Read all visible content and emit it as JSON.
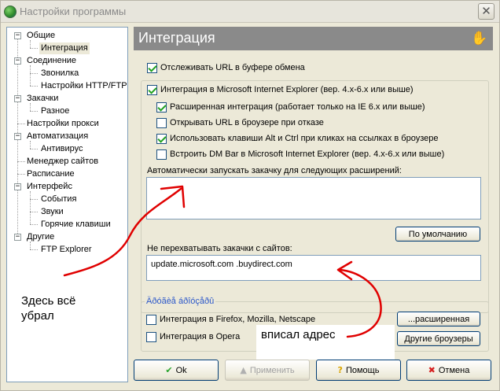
{
  "window": {
    "title": "Настройки программы",
    "close_glyph": "✕"
  },
  "tree": {
    "items": [
      {
        "label": "Общие",
        "box": "−"
      },
      {
        "label": "Интеграция"
      },
      {
        "label": "Соединение",
        "box": "−"
      },
      {
        "label": "Звонилка"
      },
      {
        "label": "Настройки HTTP/FTP"
      },
      {
        "label": "Закачки",
        "box": "−"
      },
      {
        "label": "Разное"
      },
      {
        "label": "Настройки прокси"
      },
      {
        "label": "Автоматизация",
        "box": "−"
      },
      {
        "label": "Антивирус"
      },
      {
        "label": "Менеджер сайтов"
      },
      {
        "label": "Расписание"
      },
      {
        "label": "Интерфейс",
        "box": "−"
      },
      {
        "label": "События"
      },
      {
        "label": "Звуки"
      },
      {
        "label": "Горячие клавиши"
      },
      {
        "label": "Другие",
        "box": "−"
      },
      {
        "label": "FTP Explorer"
      }
    ]
  },
  "panel": {
    "title": "Интеграция",
    "icon": "hand-icon",
    "clipboard_watch": {
      "label": "Отслеживать URL в буфере обмена",
      "checked": true
    },
    "ie_integration": {
      "label": "Интеграция в Microsoft Internet Explorer (вер. 4.x-6.x или выше)",
      "checked": true
    },
    "ie_options": [
      {
        "label": "Расширенная интеграция (работает только на IE 6.x или выше)",
        "checked": true
      },
      {
        "label": "Открывать URL в броузере при отказе",
        "checked": false
      },
      {
        "label": "Использовать клавиши Alt и Ctrl при кликах на ссылках в броузере",
        "checked": true
      },
      {
        "label": "Встроить DM Bar в Microsoft Internet Explorer (вер. 4.x-6.x или выше)",
        "checked": false
      }
    ],
    "auto_ext_label": "Автоматически запускать закачку для следующих расширений:",
    "auto_ext_value": "",
    "default_button": "По умолчанию",
    "skip_sites_label": "Не перехватывать закачки с сайтов:",
    "skip_sites_value": "update.microsoft.com .buydirect.com",
    "other_group_title": "Äðóãèå áðîóçåðû",
    "firefox": {
      "label": "Интеграция в Firefox, Mozilla, Netscape",
      "checked": false
    },
    "opera": {
      "label": "Интеграция в Opera",
      "checked": false
    },
    "advanced_button": "...расширенная",
    "other_browsers_button": "Другие броузеры"
  },
  "buttons": {
    "ok": "Ok",
    "apply": "Применить",
    "help": "Помощь",
    "cancel": "Отмена"
  },
  "annotations": {
    "left_note_line1": "Здесь всё",
    "left_note_line2": "убрал",
    "right_note": "вписал  адрес",
    "arrow_color": "#e00000"
  },
  "colors": {
    "header_bg": "#8a8a8a",
    "window_bg": "#ece9d8",
    "group_title": "#2b57c9"
  }
}
